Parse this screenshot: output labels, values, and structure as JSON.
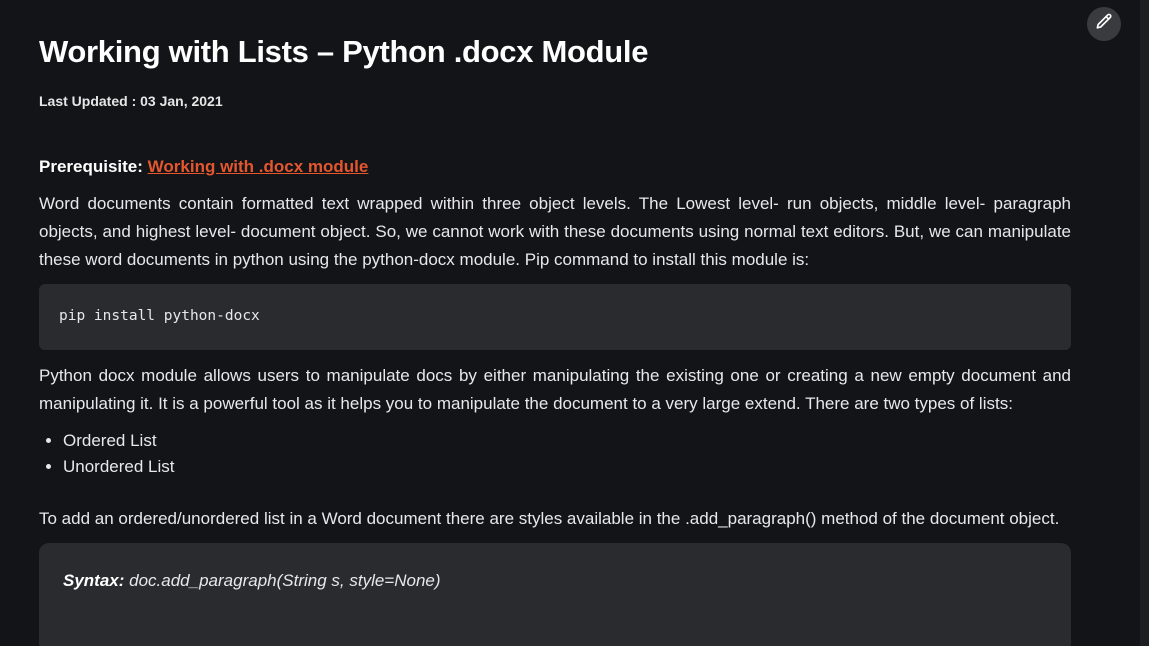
{
  "article": {
    "title": "Working with Lists – Python .docx Module",
    "last_updated": "Last Updated : 03 Jan, 2021",
    "prerequisite_label": "Prerequisite: ",
    "prerequisite_link": "Working with .docx module",
    "paragraph1": "Word documents contain formatted text wrapped within three object levels. The Lowest level- run objects, middle level- paragraph objects, and highest level- document object. So, we cannot work with these documents using normal text editors. But, we can manipulate these word documents in python using the python-docx module. Pip command to install this module is:",
    "code_install": "pip install python-docx",
    "paragraph2": "Python docx module allows users to manipulate docs by either manipulating the existing one or creating a new empty document and manipulating it. It is a powerful tool as it helps you to manipulate the document to a very large extend. There are two types of lists:",
    "list_types": [
      "Ordered List",
      "Unordered List"
    ],
    "paragraph3": "To add an ordered/unordered list in a Word document there are styles available in the .add_paragraph() method of the document object.",
    "syntax_label": "Syntax:",
    "syntax_text": " doc.add_paragraph(String s, style=None)"
  },
  "toolbar": {
    "edit_icon": "pencil-icon"
  }
}
